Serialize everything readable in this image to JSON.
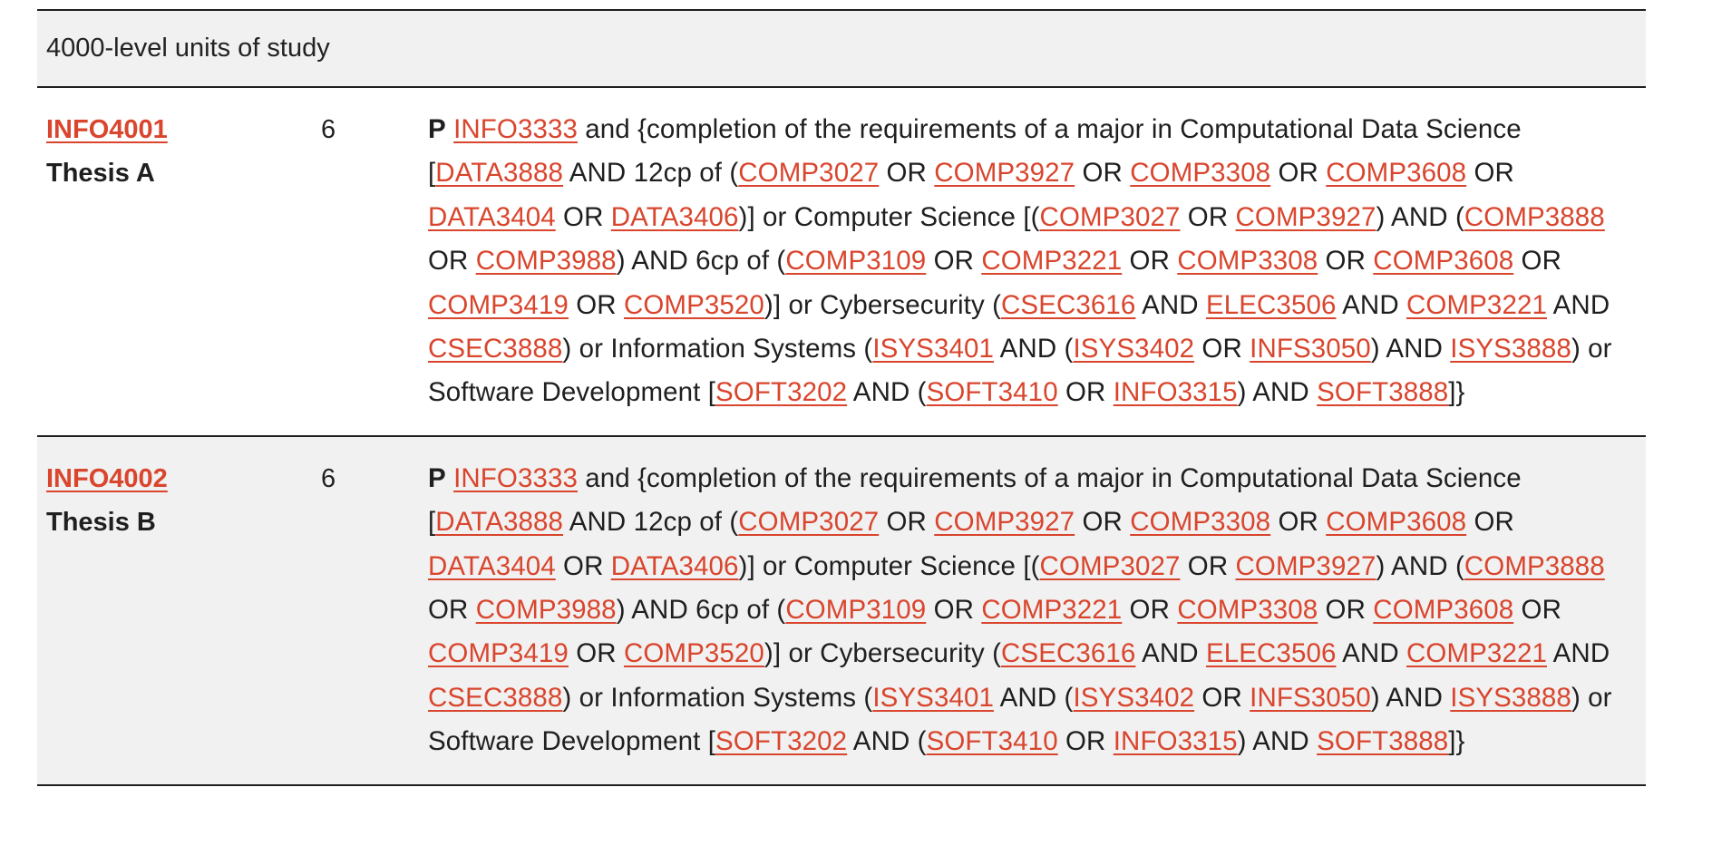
{
  "section": {
    "title": "4000-level units of study"
  },
  "units": [
    {
      "code": "INFO4001",
      "name": "Thesis A",
      "credit_points": "6",
      "requirement_prefix": "P",
      "requirement_segments": [
        {
          "t": " "
        },
        {
          "t": "INFO3333",
          "link": true
        },
        {
          "t": " and {completion of the requirements of a major in Computational Data Science ["
        },
        {
          "t": "DATA3888",
          "link": true
        },
        {
          "t": " AND 12cp of ("
        },
        {
          "t": "COMP3027",
          "link": true
        },
        {
          "t": " OR "
        },
        {
          "t": "COMP3927",
          "link": true
        },
        {
          "t": " OR "
        },
        {
          "t": "COMP3308",
          "link": true
        },
        {
          "t": " OR "
        },
        {
          "t": "COMP3608",
          "link": true
        },
        {
          "t": " OR "
        },
        {
          "t": "DATA3404",
          "link": true
        },
        {
          "t": " OR "
        },
        {
          "t": "DATA3406",
          "link": true
        },
        {
          "t": ")] or Computer Science [("
        },
        {
          "t": "COMP3027",
          "link": true
        },
        {
          "t": " OR "
        },
        {
          "t": "COMP3927",
          "link": true
        },
        {
          "t": ") AND ("
        },
        {
          "t": "COMP3888",
          "link": true
        },
        {
          "t": " OR "
        },
        {
          "t": "COMP3988",
          "link": true
        },
        {
          "t": ") AND 6cp of ("
        },
        {
          "t": "COMP3109",
          "link": true
        },
        {
          "t": " OR "
        },
        {
          "t": "COMP3221",
          "link": true
        },
        {
          "t": " OR "
        },
        {
          "t": "COMP3308",
          "link": true
        },
        {
          "t": " OR "
        },
        {
          "t": "COMP3608",
          "link": true
        },
        {
          "t": " OR "
        },
        {
          "t": "COMP3419",
          "link": true
        },
        {
          "t": " OR "
        },
        {
          "t": "COMP3520",
          "link": true
        },
        {
          "t": ")] or Cybersecurity ("
        },
        {
          "t": "CSEC3616",
          "link": true
        },
        {
          "t": " AND "
        },
        {
          "t": "ELEC3506",
          "link": true
        },
        {
          "t": " AND "
        },
        {
          "t": "COMP3221",
          "link": true
        },
        {
          "t": " AND "
        },
        {
          "t": "CSEC3888",
          "link": true
        },
        {
          "t": ") or Information Systems ("
        },
        {
          "t": "ISYS3401",
          "link": true
        },
        {
          "t": " AND ("
        },
        {
          "t": "ISYS3402",
          "link": true
        },
        {
          "t": " OR "
        },
        {
          "t": "INFS3050",
          "link": true
        },
        {
          "t": ") AND "
        },
        {
          "t": "ISYS3888",
          "link": true
        },
        {
          "t": ") or Software Development ["
        },
        {
          "t": "SOFT3202",
          "link": true
        },
        {
          "t": " AND ("
        },
        {
          "t": "SOFT3410",
          "link": true
        },
        {
          "t": " OR "
        },
        {
          "t": "INFO3315",
          "link": true
        },
        {
          "t": ") AND "
        },
        {
          "t": "SOFT3888",
          "link": true
        },
        {
          "t": "]}"
        }
      ]
    },
    {
      "code": "INFO4002",
      "name": "Thesis B",
      "credit_points": "6",
      "requirement_prefix": "P",
      "requirement_segments": [
        {
          "t": " "
        },
        {
          "t": "INFO3333",
          "link": true
        },
        {
          "t": " and {completion of the requirements of a major in Computational Data Science ["
        },
        {
          "t": "DATA3888",
          "link": true
        },
        {
          "t": " AND 12cp of ("
        },
        {
          "t": "COMP3027",
          "link": true
        },
        {
          "t": " OR "
        },
        {
          "t": "COMP3927",
          "link": true
        },
        {
          "t": " OR "
        },
        {
          "t": "COMP3308",
          "link": true
        },
        {
          "t": " OR "
        },
        {
          "t": "COMP3608",
          "link": true
        },
        {
          "t": " OR "
        },
        {
          "t": "DATA3404",
          "link": true
        },
        {
          "t": " OR "
        },
        {
          "t": "DATA3406",
          "link": true
        },
        {
          "t": ")] or Computer Science [("
        },
        {
          "t": "COMP3027",
          "link": true
        },
        {
          "t": " OR "
        },
        {
          "t": "COMP3927",
          "link": true
        },
        {
          "t": ") AND ("
        },
        {
          "t": "COMP3888",
          "link": true
        },
        {
          "t": " OR "
        },
        {
          "t": "COMP3988",
          "link": true
        },
        {
          "t": ") AND 6cp of ("
        },
        {
          "t": "COMP3109",
          "link": true
        },
        {
          "t": " OR "
        },
        {
          "t": "COMP3221",
          "link": true
        },
        {
          "t": " OR "
        },
        {
          "t": "COMP3308",
          "link": true
        },
        {
          "t": " OR "
        },
        {
          "t": "COMP3608",
          "link": true
        },
        {
          "t": " OR "
        },
        {
          "t": "COMP3419",
          "link": true
        },
        {
          "t": " OR "
        },
        {
          "t": "COMP3520",
          "link": true
        },
        {
          "t": ")] or Cybersecurity ("
        },
        {
          "t": "CSEC3616",
          "link": true
        },
        {
          "t": " AND "
        },
        {
          "t": "ELEC3506",
          "link": true
        },
        {
          "t": " AND "
        },
        {
          "t": "COMP3221",
          "link": true
        },
        {
          "t": " AND "
        },
        {
          "t": "CSEC3888",
          "link": true
        },
        {
          "t": ") or Information Systems ("
        },
        {
          "t": "ISYS3401",
          "link": true
        },
        {
          "t": " AND ("
        },
        {
          "t": "ISYS3402",
          "link": true
        },
        {
          "t": " OR "
        },
        {
          "t": "INFS3050",
          "link": true
        },
        {
          "t": ") AND "
        },
        {
          "t": "ISYS3888",
          "link": true
        },
        {
          "t": ") or Software Development ["
        },
        {
          "t": "SOFT3202",
          "link": true
        },
        {
          "t": " AND ("
        },
        {
          "t": "SOFT3410",
          "link": true
        },
        {
          "t": " OR "
        },
        {
          "t": "INFO3315",
          "link": true
        },
        {
          "t": ") AND "
        },
        {
          "t": "SOFT3888",
          "link": true
        },
        {
          "t": "]}"
        }
      ]
    }
  ],
  "colors": {
    "link": "#d9452d",
    "header_bg": "#f1f1f1",
    "text": "#1f1f1f"
  }
}
